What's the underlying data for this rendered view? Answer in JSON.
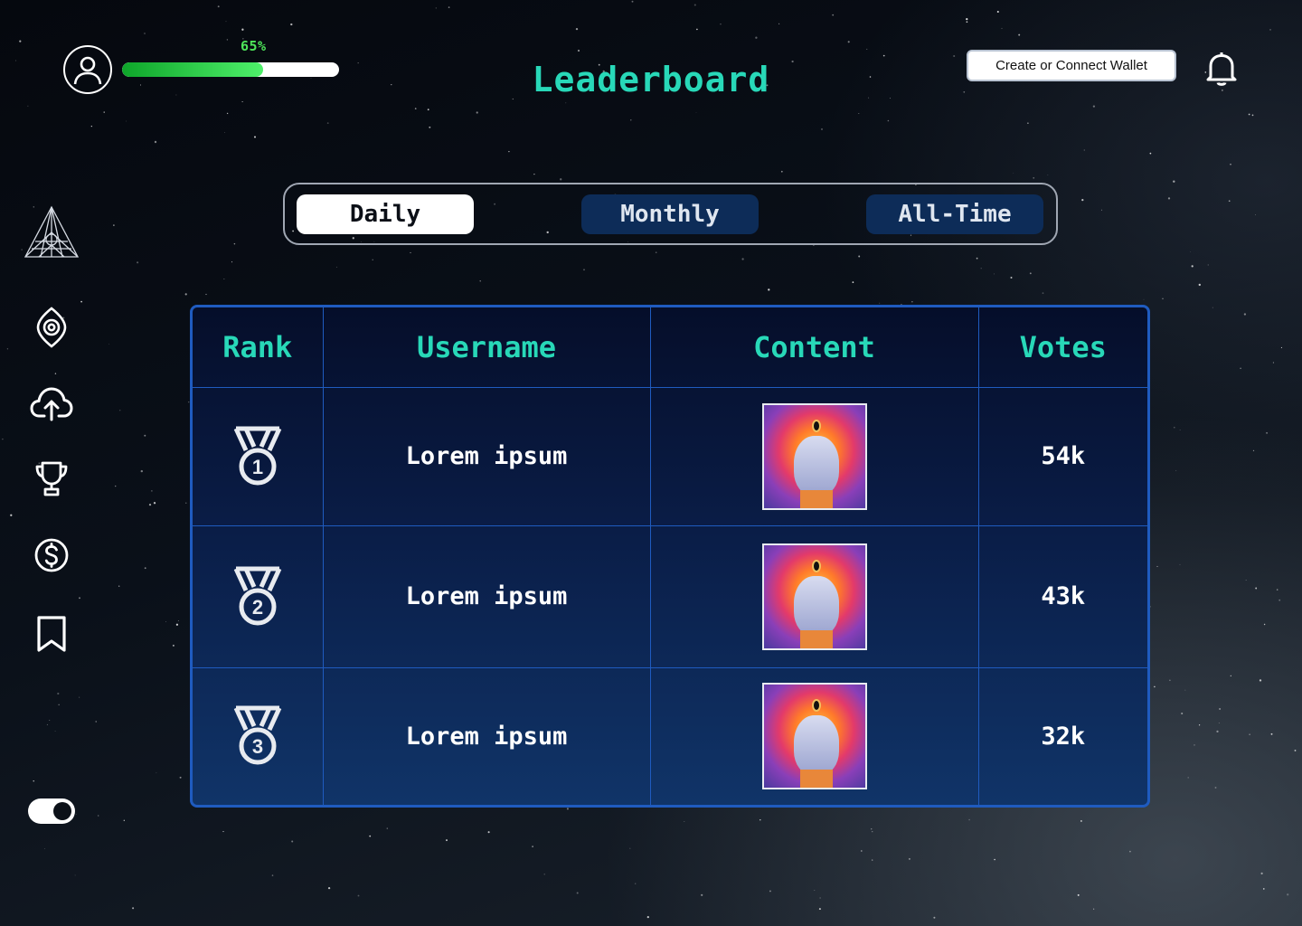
{
  "header": {
    "progress_label": "65%",
    "progress_percent": 65,
    "title": "Leaderboard",
    "wallet_button": "Create or Connect Wallet"
  },
  "icons": {
    "avatar": "user-icon",
    "notifications": "bell-icon",
    "sidebar": [
      "logo-pyramid-icon",
      "eye-icon",
      "cloud-upload-icon",
      "trophy-icon",
      "dollar-icon",
      "bookmark-icon"
    ],
    "theme_toggle": "toggle-switch"
  },
  "tabs": [
    {
      "label": "Daily",
      "active": true
    },
    {
      "label": "Monthly",
      "active": false
    },
    {
      "label": "All-Time",
      "active": false
    }
  ],
  "table": {
    "headers": [
      "Rank",
      "Username",
      "Content",
      "Votes"
    ],
    "rows": [
      {
        "rank": "1",
        "username": "Lorem ipsum",
        "votes": "54k"
      },
      {
        "rank": "2",
        "username": "Lorem ipsum",
        "votes": "43k"
      },
      {
        "rank": "3",
        "username": "Lorem ipsum",
        "votes": "32k"
      }
    ]
  },
  "colors": {
    "accent_teal": "#28d8b8",
    "progress_green": "#4ee65a",
    "table_border": "#1f5bbf",
    "tab_inactive": "#0d2c58"
  }
}
